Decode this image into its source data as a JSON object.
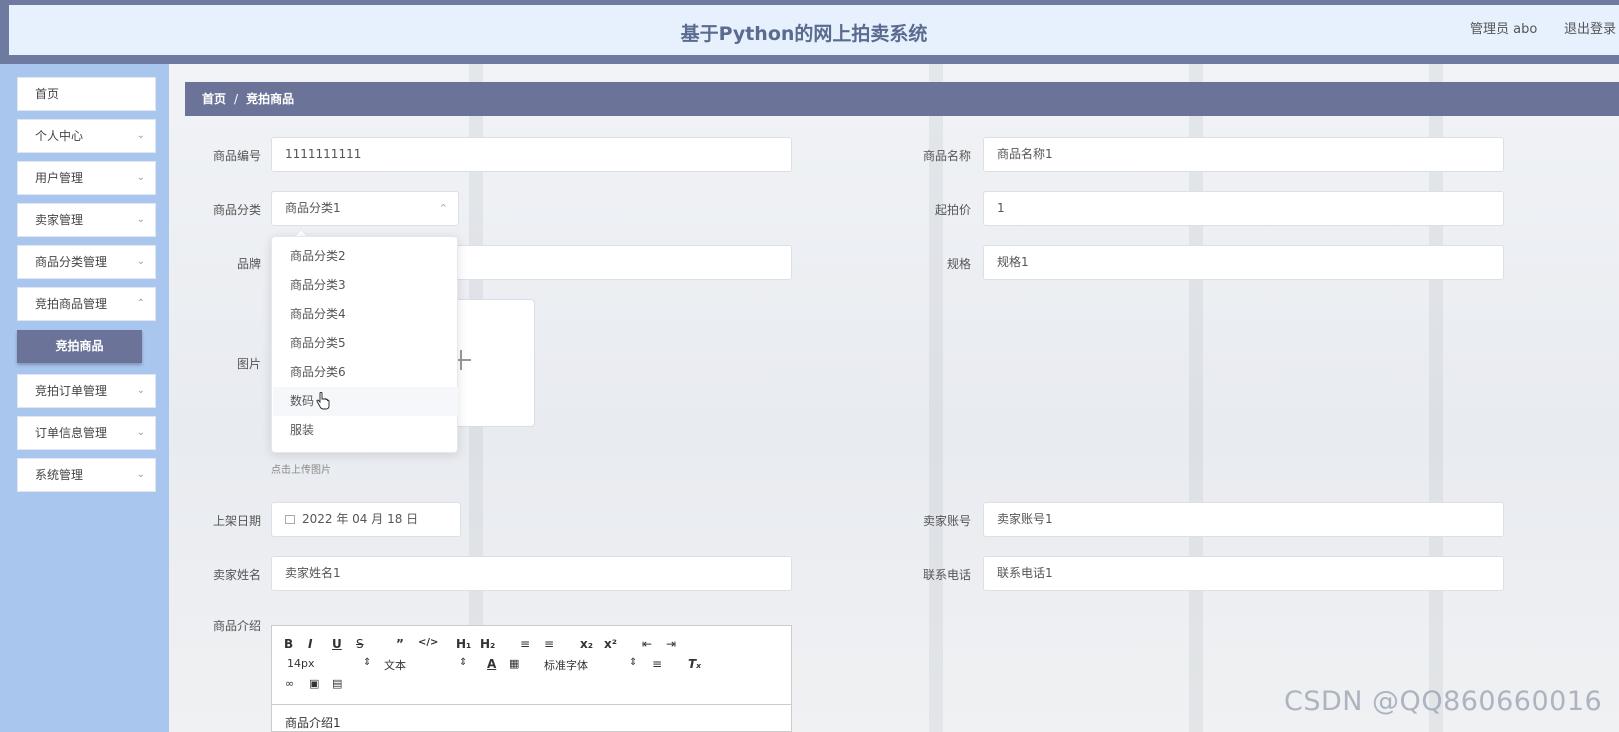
{
  "header": {
    "title": "基于Python的网上拍卖系统",
    "user": "管理员 abo",
    "logout": "退出登录"
  },
  "sidebar": {
    "items": [
      {
        "label": "首页"
      },
      {
        "label": "个人中心"
      },
      {
        "label": "用户管理"
      },
      {
        "label": "卖家管理"
      },
      {
        "label": "商品分类管理"
      },
      {
        "label": "竞拍商品管理"
      },
      {
        "label": "竞拍订单管理"
      },
      {
        "label": "订单信息管理"
      },
      {
        "label": "系统管理"
      }
    ],
    "active_sub": "竞拍商品"
  },
  "breadcrumb": {
    "home": "首页",
    "separator": "/",
    "current": "竞拍商品"
  },
  "form": {
    "code_label": "商品编号",
    "code_value": "1111111111",
    "name_label": "商品名称",
    "name_value": "商品名称1",
    "category_label": "商品分类",
    "category_value": "商品分类1",
    "start_price_label": "起拍价",
    "start_price_value": "1",
    "brand_label": "品牌",
    "spec_label": "规格",
    "spec_value": "规格1",
    "image_label": "图片",
    "upload_hint": "点击上传图片",
    "date_label": "上架日期",
    "date_value": "2022 年 04 月 18 日",
    "seller_account_label": "卖家账号",
    "seller_account_value": "卖家账号1",
    "seller_name_label": "卖家姓名",
    "seller_name_value": "卖家姓名1",
    "phone_label": "联系电话",
    "phone_value": "联系电话1",
    "intro_label": "商品介绍",
    "intro_value": "商品介绍1"
  },
  "dropdown": {
    "options": [
      "商品分类2",
      "商品分类3",
      "商品分类4",
      "商品分类5",
      "商品分类6",
      "数码",
      "服装"
    ],
    "hovered": "数码"
  },
  "editor": {
    "font_size": "14px",
    "text_type": "文本",
    "font_family": "标准字体"
  },
  "watermark": "CSDN @QQ860660016",
  "colors": {
    "header_bar": "#6e7aa0",
    "header_bg": "#e6f1fd",
    "sidebar_bg": "#a9c6ee",
    "accent": "#6c7399"
  }
}
